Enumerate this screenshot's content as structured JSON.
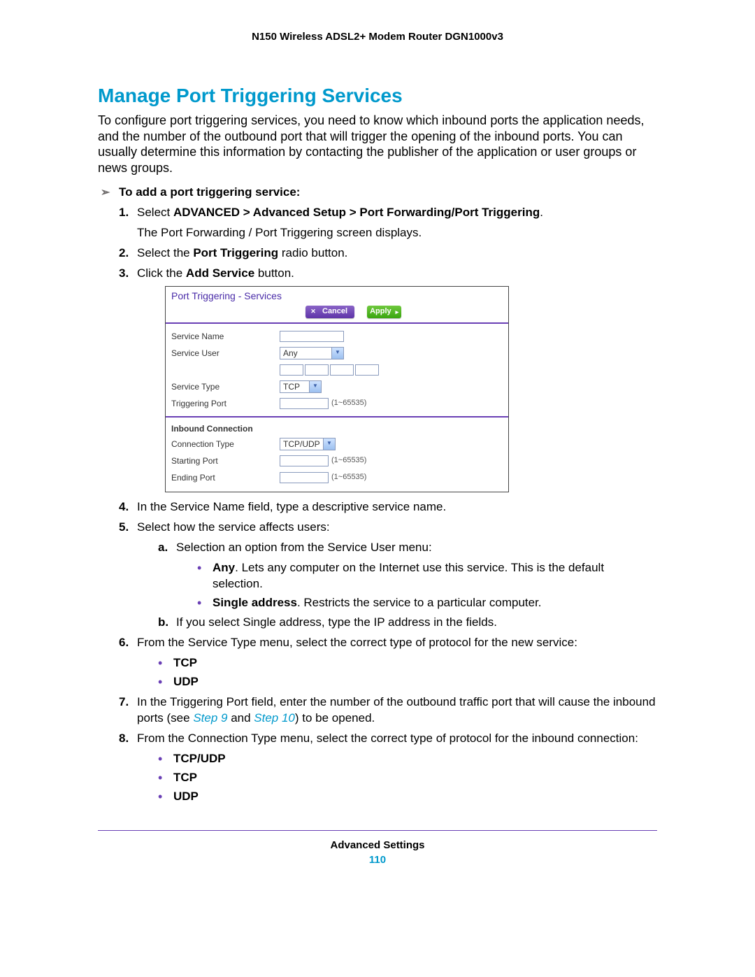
{
  "header": {
    "title": "N150 Wireless ADSL2+ Modem Router DGN1000v3"
  },
  "section": {
    "title": "Manage Port Triggering Services",
    "intro": "To configure port triggering services, you need to know which inbound ports the application needs, and the number of the outbound port that will trigger the opening of the inbound ports. You can usually determine this information by contacting the publisher of the application or user groups or news groups.",
    "task_heading": "To add a port triggering service:"
  },
  "steps": {
    "s1_prefix": "Select ",
    "s1_bold": "ADVANCED > Advanced Setup > Port Forwarding/Port Triggering",
    "s1_suffix": ".",
    "s1_note": "The Port Forwarding / Port Triggering screen displays.",
    "s2_a": "Select the ",
    "s2_b": "Port Triggering",
    "s2_c": " radio button.",
    "s3_a": "Click the ",
    "s3_b": "Add Service",
    "s3_c": " button.",
    "s4": "In the Service Name field, type a descriptive service name.",
    "s5": "Select how the service affects users:",
    "s5a": "Selection an option from the Service User menu:",
    "s5a_any_b": "Any",
    "s5a_any_t": ". Lets any computer on the Internet use this service. This is the default selection.",
    "s5a_single_b": "Single address",
    "s5a_single_t": ". Restricts the service to a particular computer.",
    "s5b": "If you select Single address, type the IP address in the fields.",
    "s6": "From the Service Type menu, select the correct type of protocol for the new service:",
    "s6_opt1": "TCP",
    "s6_opt2": "UDP",
    "s7_a": "In the Triggering Port field, enter the number of the outbound traffic port that will cause the inbound ports (see ",
    "s7_link1": "Step 9",
    "s7_mid": " and ",
    "s7_link2": "Step 10",
    "s7_b": ") to be opened.",
    "s8": "From the Connection Type menu, select the correct type of protocol for the inbound connection:",
    "s8_opt1": "TCP/UDP",
    "s8_opt2": "TCP",
    "s8_opt3": "UDP"
  },
  "ui": {
    "title": "Port Triggering - Services",
    "cancel": "Cancel",
    "apply": "Apply",
    "service_name": "Service Name",
    "service_user": "Service User",
    "service_user_value": "Any",
    "service_type": "Service Type",
    "service_type_value": "TCP",
    "triggering_port": "Triggering Port",
    "port_range": "(1~65535)",
    "inbound_heading": "Inbound Connection",
    "conn_type": "Connection Type",
    "conn_type_value": "TCP/UDP",
    "starting_port": "Starting Port",
    "ending_port": "Ending Port"
  },
  "footer": {
    "label": "Advanced Settings",
    "page": "110"
  }
}
